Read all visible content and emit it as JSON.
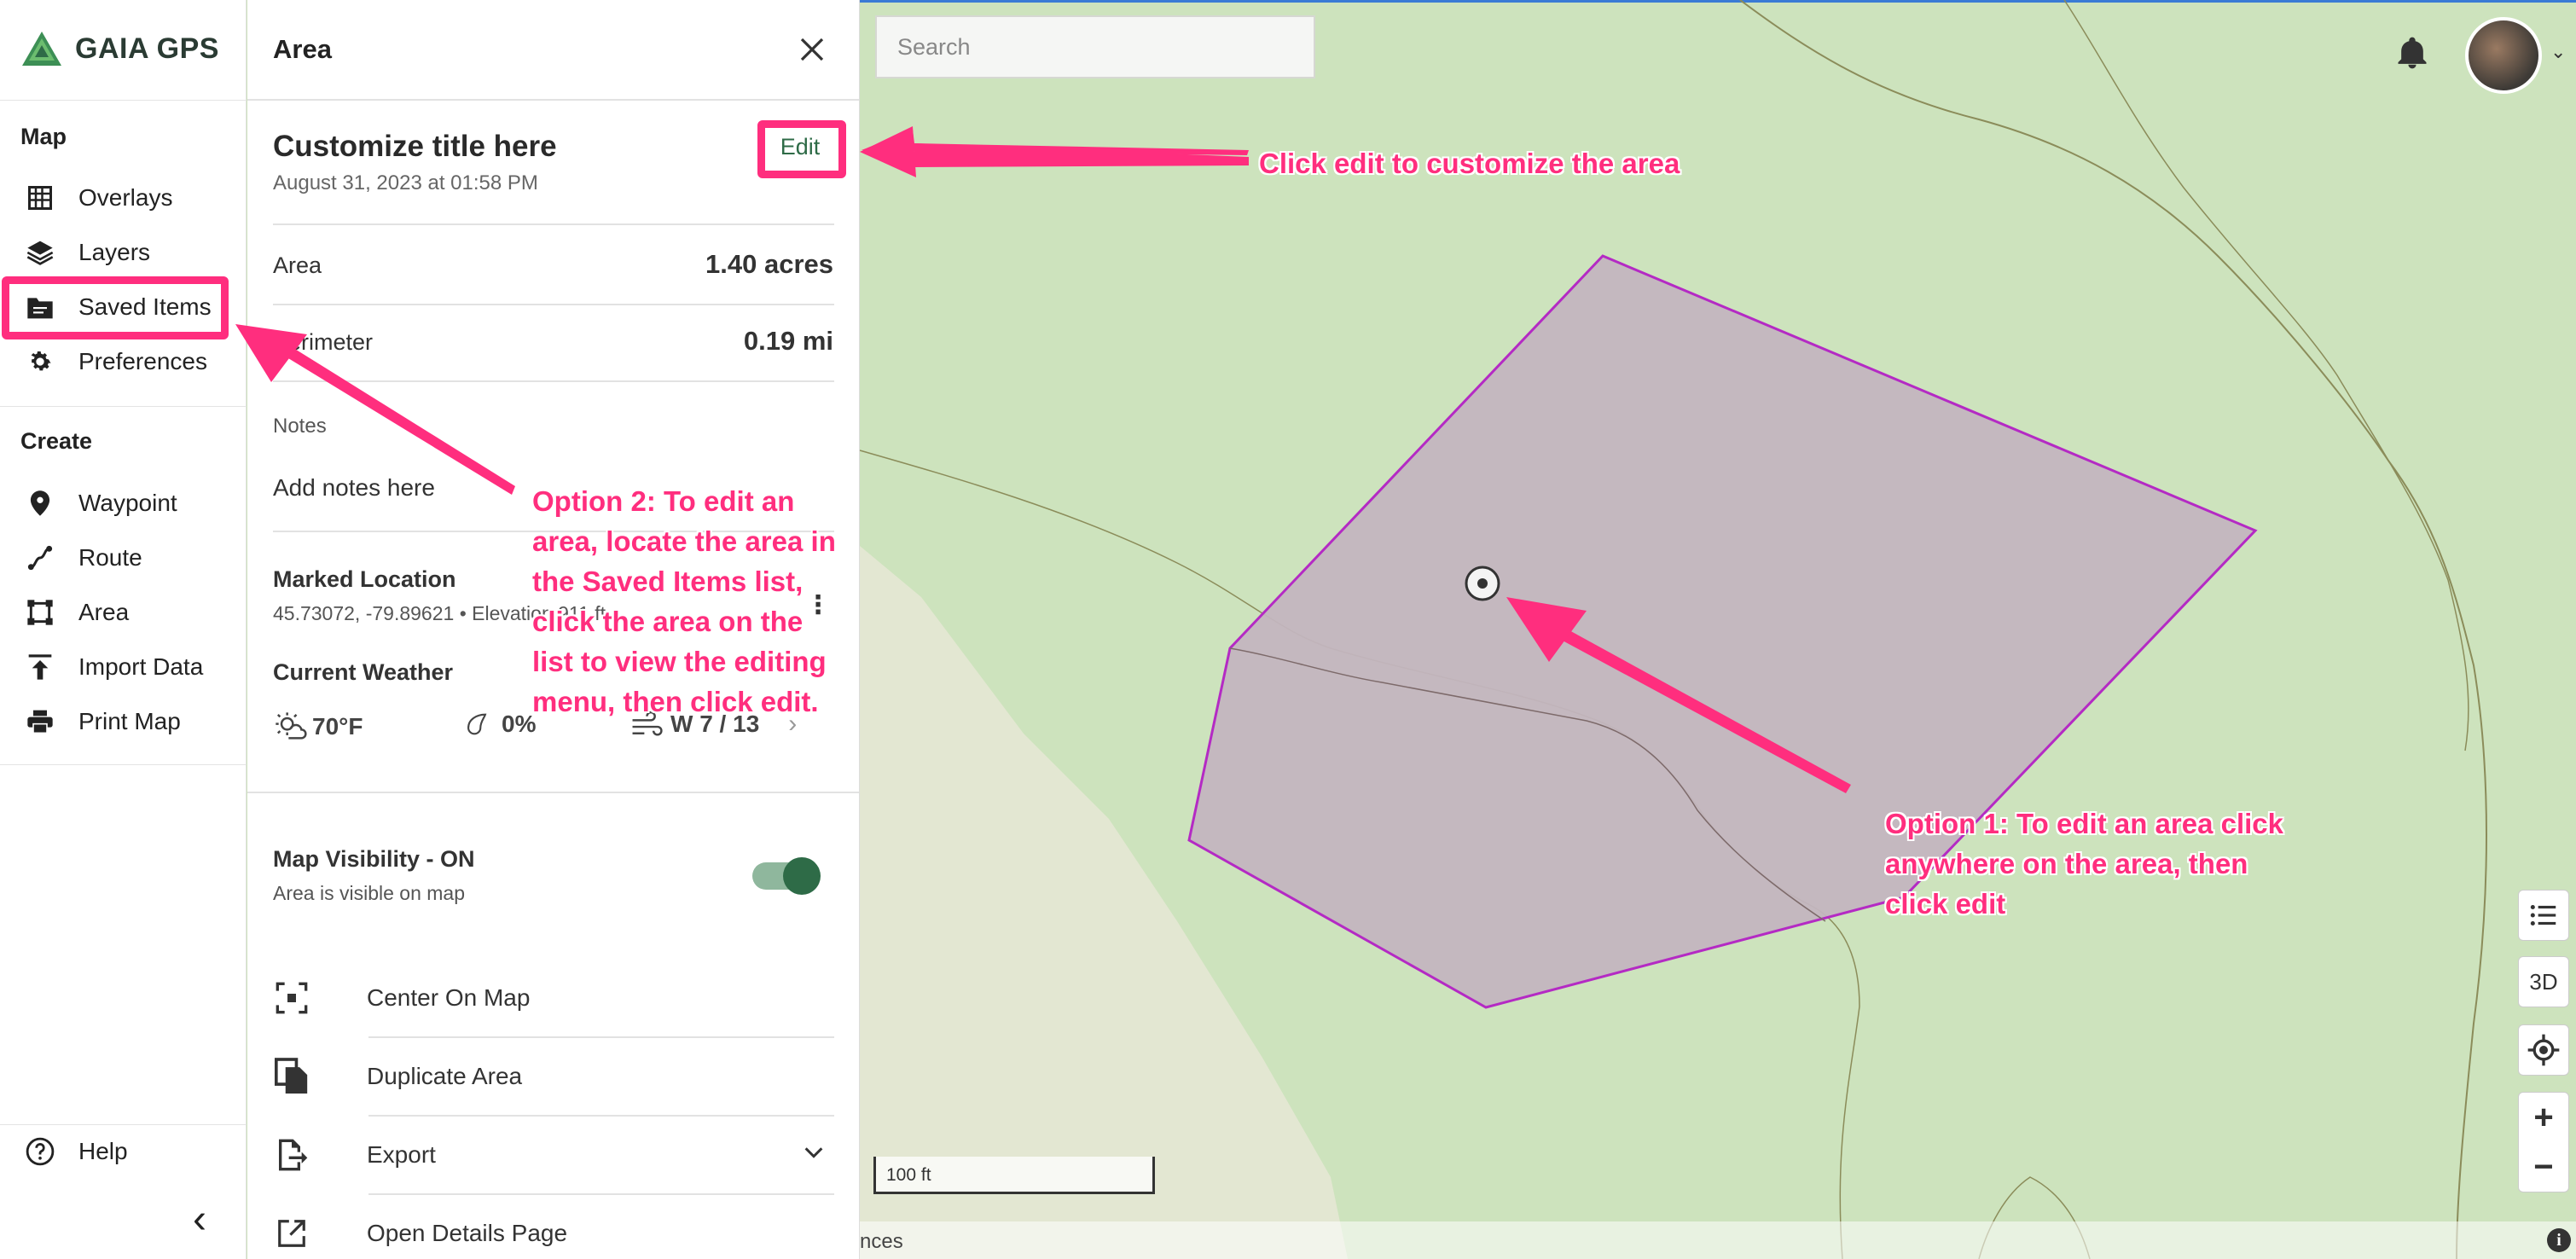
{
  "app": {
    "brand": "GAIA GPS",
    "accent": "#2e6b47",
    "annotation_color": "#ff2e7e"
  },
  "nav": {
    "map_heading": "Map",
    "map_items": [
      {
        "label": "Overlays",
        "icon": "grid-icon"
      },
      {
        "label": "Layers",
        "icon": "layers-icon"
      },
      {
        "label": "Saved Items",
        "icon": "folder-icon"
      },
      {
        "label": "Preferences",
        "icon": "gear-icon"
      }
    ],
    "create_heading": "Create",
    "create_items": [
      {
        "label": "Waypoint",
        "icon": "pin-icon"
      },
      {
        "label": "Route",
        "icon": "route-icon"
      },
      {
        "label": "Area",
        "icon": "area-icon"
      },
      {
        "label": "Import Data",
        "icon": "upload-icon"
      },
      {
        "label": "Print Map",
        "icon": "printer-icon"
      }
    ],
    "help": "Help",
    "collapse": "‹"
  },
  "panel": {
    "title": "Area",
    "item_title": "Customize title here",
    "item_date": "August 31, 2023 at 01:58 PM",
    "edit_label": "Edit",
    "area_label": "Area",
    "area_value": "1.40 acres",
    "perimeter_label": "Perimeter",
    "perimeter_value": "0.19 mi",
    "notes_label": "Notes",
    "notes_text": "Add notes here",
    "marked_location_title": "Marked Location",
    "marked_location_sub": "45.73072, -79.89621 • Elevation 911 ft",
    "weather_title": "Current Weather",
    "weather_temp": "70°F",
    "weather_precip": "0%",
    "weather_wind": "W 7 / 13",
    "visibility_title": "Map Visibility - ON",
    "visibility_sub": "Area is visible on map",
    "visibility_on": true,
    "actions": [
      {
        "label": "Center On Map",
        "icon": "center-icon"
      },
      {
        "label": "Duplicate Area",
        "icon": "duplicate-icon"
      },
      {
        "label": "Export",
        "icon": "export-icon"
      },
      {
        "label": "Open Details Page",
        "icon": "external-link-icon"
      }
    ]
  },
  "map": {
    "search_placeholder": "Search",
    "scale_label": "100 ft",
    "attribution": "nces",
    "btn_3d": "3D",
    "zoom_in": "+",
    "zoom_out": "−",
    "info": "i",
    "area_fill": "#c3b5bf",
    "area_stroke": "#b42ac4"
  },
  "annotations": {
    "edit_hint": "Click edit to customize the area",
    "option2": [
      "Option 2: To edit an",
      "area, locate the area in",
      "the Saved Items list,",
      "click the area on the",
      "list to view the editing",
      "menu, then click edit."
    ],
    "option1": [
      "Option 1: To edit an area click",
      "anywhere on the area, then",
      "click edit"
    ]
  }
}
